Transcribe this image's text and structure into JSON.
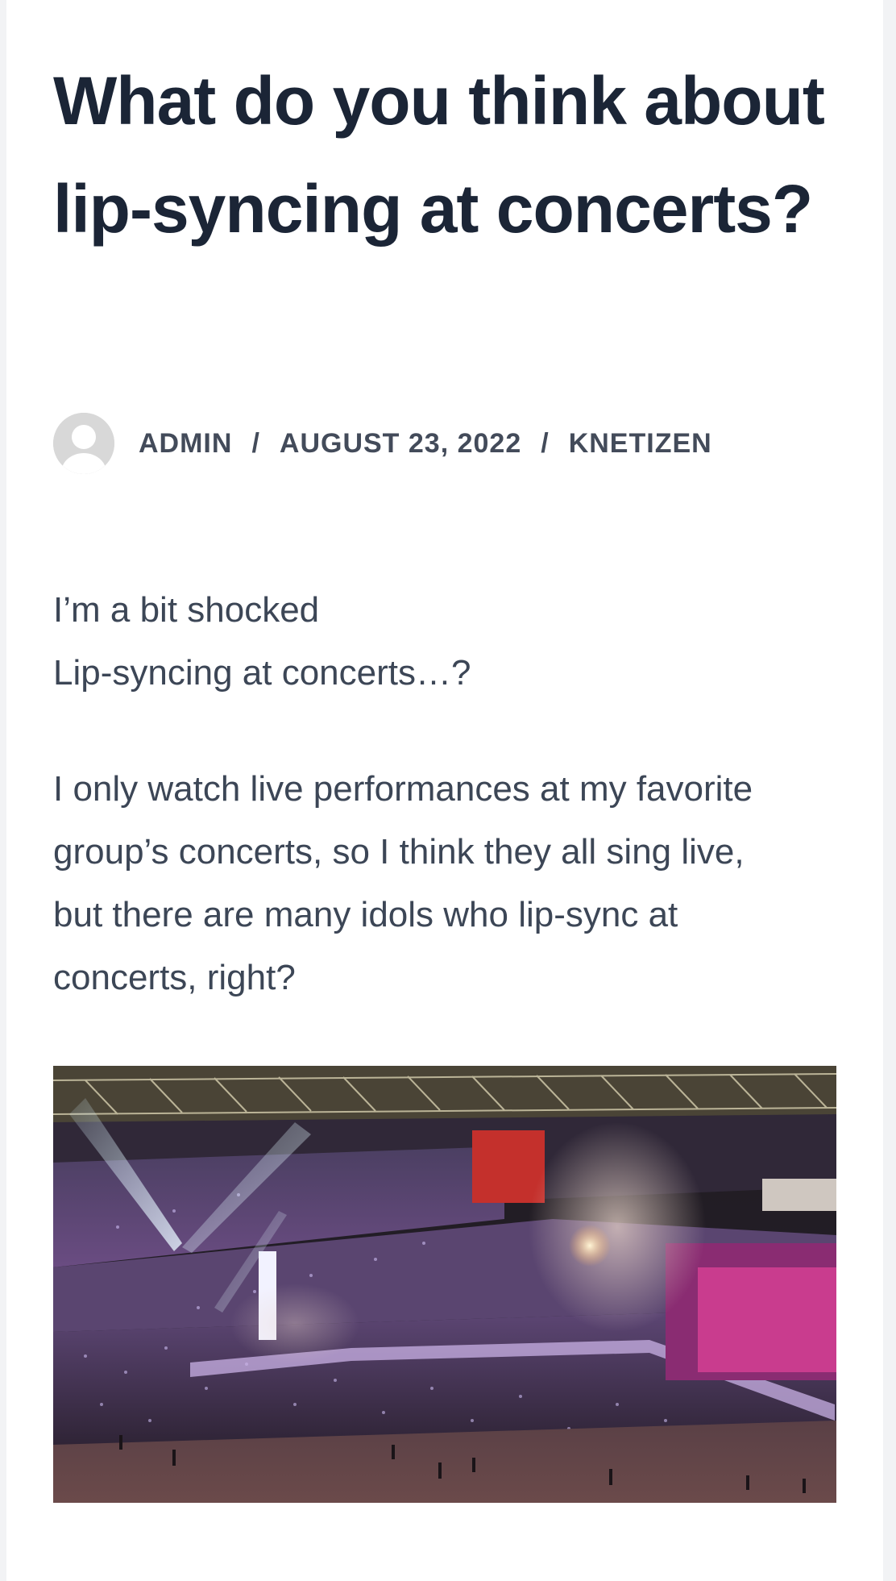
{
  "article": {
    "title": "What do you think about lip-syncing at concerts?",
    "meta": {
      "avatar_icon": "user-avatar-placeholder-icon",
      "author": "ADMIN",
      "separator": "/",
      "date": "AUGUST 23, 2022",
      "category": "KNETIZEN"
    },
    "paragraphs": [
      [
        "I’m a bit shocked",
        "Lip-syncing at concerts…?"
      ],
      [
        "I only watch live performances at my favorite",
        "group’s concerts, so I think they all sing live,",
        "but there are many idols who lip-sync at",
        "concerts, right?"
      ]
    ],
    "image": {
      "icon": "stadium-concert-photo"
    }
  },
  "colors": {
    "title": "#1b2536",
    "meta": "#434b5a",
    "body_text": "#3c4656",
    "background": "#ffffff"
  }
}
